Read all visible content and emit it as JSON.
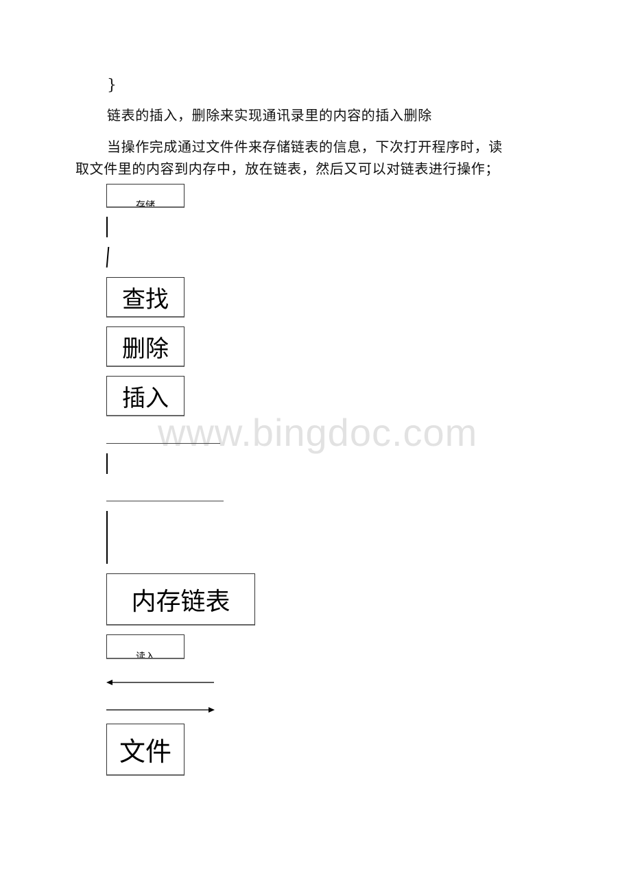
{
  "document": {
    "closing_brace": "}",
    "paragraph1": "链表的插入，删除来实现通讯录里的内容的插入删除",
    "paragraph2_line1": "当操作完成通过文件件来存储链表的信息，下次打开程序时，读",
    "paragraph2_line2": "取文件里的内容到内存中，放在链表，然后又可以对链表进行操作；"
  },
  "diagram": {
    "boxes": {
      "store": "存储",
      "search": "查找",
      "delete": "删除",
      "insert": "插入",
      "memory_list": "内存链表",
      "read": "读入",
      "file": "文件"
    },
    "arrows": [
      {
        "direction": "left"
      },
      {
        "direction": "right"
      }
    ]
  },
  "watermark": {
    "text": "www.bingdoc.com",
    "color": "#e2e2e2"
  }
}
